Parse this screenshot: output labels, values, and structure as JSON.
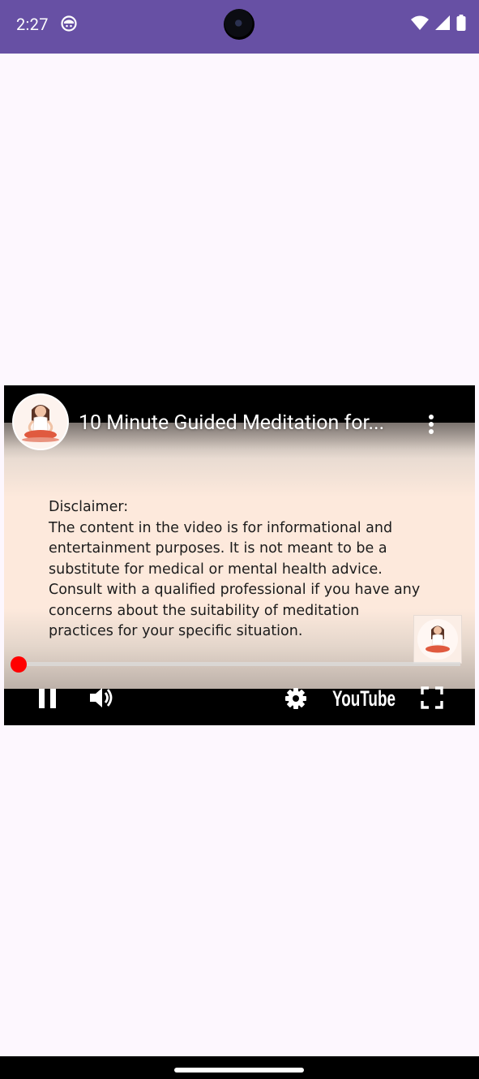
{
  "status_bar": {
    "time": "2:27",
    "background": "#6750a4",
    "icons": [
      "app-notification-icon",
      "wifi-icon",
      "cell-signal-icon",
      "battery-icon"
    ]
  },
  "video": {
    "title": "10 Minute Guided Meditation for...",
    "disclaimer_lines": [
      "Disclaimer:",
      "The content in the video is for informational and",
      "entertainment purposes. It is not meant to be a",
      "substitute for medical or mental health advice.",
      "Consult with a qualified professional if you have any",
      "concerns about the suitability of meditation",
      "practices for your specific situation."
    ],
    "progress_fraction": 0.0,
    "is_playing": true,
    "youtube_label": "YouTube",
    "accent_color": "#ff0000"
  },
  "app_background": "#fdf7fe"
}
